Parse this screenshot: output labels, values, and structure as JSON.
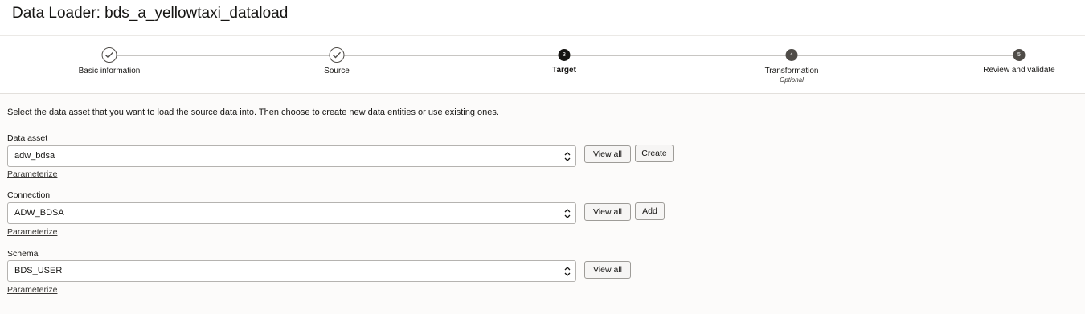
{
  "header": {
    "title": "Data Loader: bds_a_yellowtaxi_dataload"
  },
  "wizard": {
    "steps": [
      {
        "number": "1",
        "label": "Basic information",
        "status": "complete",
        "sublabel": ""
      },
      {
        "number": "2",
        "label": "Source",
        "status": "complete",
        "sublabel": ""
      },
      {
        "number": "3",
        "label": "Target",
        "status": "current",
        "sublabel": ""
      },
      {
        "number": "4",
        "label": "Transformation",
        "status": "upcoming",
        "sublabel": "Optional"
      },
      {
        "number": "5",
        "label": "Review and validate",
        "status": "upcoming",
        "sublabel": ""
      }
    ]
  },
  "main": {
    "intro": "Select the data asset that you want to load the source data into. Then choose to create new data entities or use existing ones.",
    "data_asset": {
      "label": "Data asset",
      "value": "adw_bdsa",
      "view_all": "View all",
      "create": "Create",
      "parameterize": "Parameterize"
    },
    "connection": {
      "label": "Connection",
      "value": "ADW_BDSA",
      "view_all": "View all",
      "add": "Add",
      "parameterize": "Parameterize"
    },
    "schema": {
      "label": "Schema",
      "value": "BDS_USER",
      "view_all": "View all",
      "parameterize": "Parameterize"
    }
  },
  "colors": {
    "background": "#fcfbfa",
    "text": "#161513",
    "step_current": "#161513",
    "step_upcoming": "#4f4c48"
  },
  "icons": {
    "step_complete": "check-circle-icon",
    "select_toggle": "chevron-up-down-icon"
  }
}
